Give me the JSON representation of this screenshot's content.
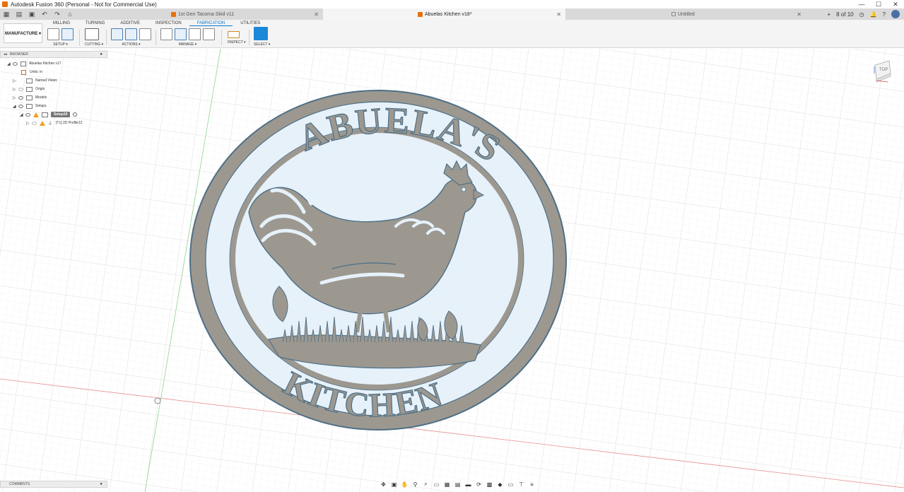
{
  "window": {
    "title": "Autodesk Fusion 360 (Personal - Not for Commercial Use)",
    "min_label": "—",
    "max_label": "☐",
    "close_label": "✕"
  },
  "tabs": [
    {
      "label": "1st Gen Tacoma Skid v11",
      "icon": "fusion-doc-icon",
      "active": false
    },
    {
      "label": "Abuelas Kitchen v18*",
      "icon": "fusion-doc-icon",
      "active": true
    },
    {
      "label": "Untitled",
      "icon": "lock-icon",
      "active": false
    }
  ],
  "tabbar_right": {
    "jobs_label": "8 of 10"
  },
  "ribbon": {
    "workspace_label": "MANUFACTURE ▾",
    "tabs": [
      "MILLING",
      "TURNING",
      "ADDITIVE",
      "INSPECTION",
      "FABRICATION",
      "UTILITIES"
    ],
    "active_tab": "FABRICATION",
    "groups": {
      "setup": "SETUP ▾",
      "cutting": "CUTTING ▾",
      "actions": "ACTIONS ▾",
      "manage": "MANAGE ▾",
      "inspect": "INSPECT ▾",
      "select": "SELECT ▾"
    }
  },
  "browser": {
    "header": "BROWSER",
    "items": [
      {
        "label": "Abuelas Kitchen v17"
      },
      {
        "label": "Units: in"
      },
      {
        "label": "Named Views"
      },
      {
        "label": "Origin"
      },
      {
        "label": "Models"
      },
      {
        "label": "Setups"
      },
      {
        "label": "Setup19"
      },
      {
        "label": "[T1] 2D Profile12"
      }
    ]
  },
  "comments": {
    "label": "COMMENTS"
  },
  "model": {
    "top_text": "ABUELA'S",
    "bottom_text": "KITCHEN",
    "sign_color": "#9c9890",
    "outline_color": "#4d6f86",
    "pocket_color": "#e6f1fa"
  },
  "viewcube": {
    "label": "TOP"
  }
}
